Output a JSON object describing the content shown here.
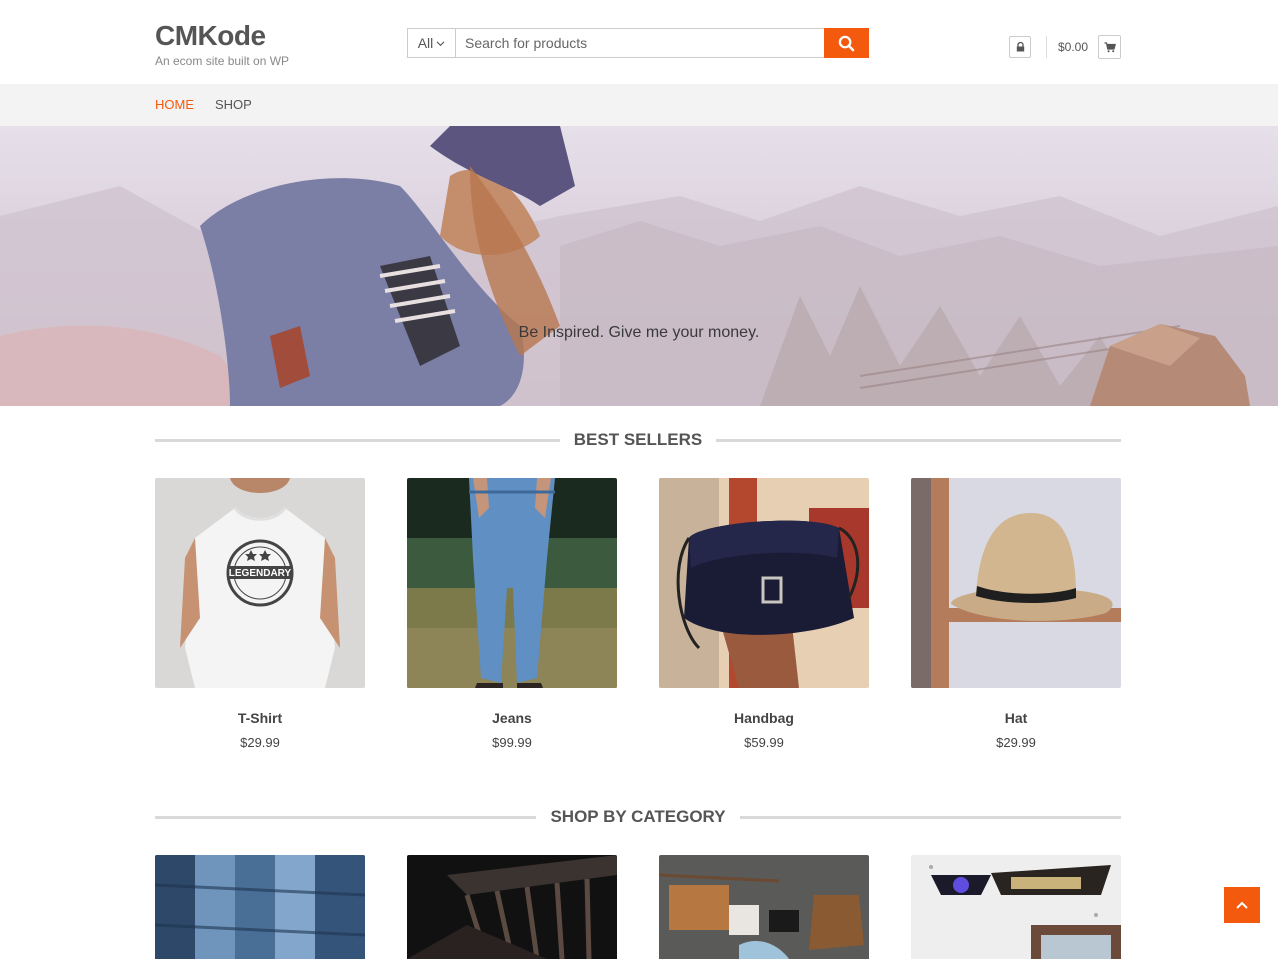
{
  "site": {
    "title": "CMKode",
    "description": "An ecom site built on WP"
  },
  "search": {
    "category": "All",
    "placeholder": "Search for products"
  },
  "header": {
    "cart_total": "$0.00"
  },
  "nav": [
    {
      "label": "HOME",
      "active": true
    },
    {
      "label": "SHOP",
      "active": false
    }
  ],
  "hero": {
    "tagline": "Be Inspired. Give me your money."
  },
  "best_sellers": {
    "title": "BEST SELLERS",
    "products": [
      {
        "name": "T-Shirt",
        "price": "$29.99"
      },
      {
        "name": "Jeans",
        "price": "$99.99"
      },
      {
        "name": "Handbag",
        "price": "$59.99"
      },
      {
        "name": "Hat",
        "price": "$29.99"
      }
    ]
  },
  "shop_by_category": {
    "title": "SHOP BY CATEGORY"
  },
  "colors": {
    "accent": "#f35a0e",
    "nav_bg": "#f3f3f3",
    "text": "#444444"
  },
  "icons": [
    "search-icon",
    "lock-icon",
    "cart-icon",
    "chevron-down-icon",
    "chevron-up-icon"
  ]
}
